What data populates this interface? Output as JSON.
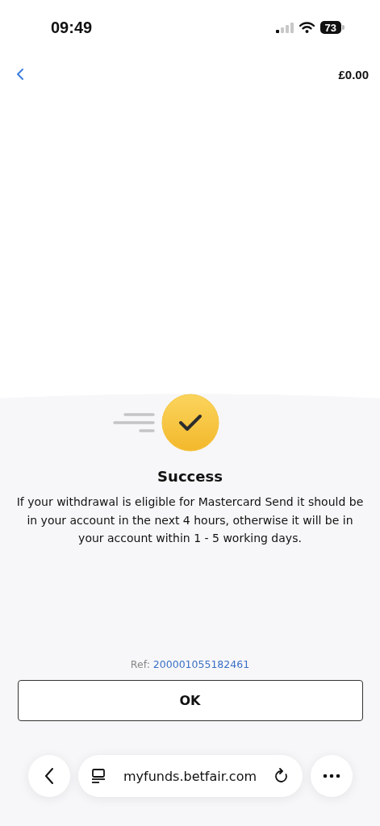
{
  "status_bar": {
    "time": "09:49",
    "battery": "73"
  },
  "header": {
    "balance": "£0.00"
  },
  "result": {
    "title": "Success",
    "message": "If your withdrawal is eligible for Mastercard Send it should be in your account in the next 4 hours, otherwise it will be in your account within 1 - 5 working days.",
    "ref_label": "Ref:",
    "ref_number": "200001055182461"
  },
  "buttons": [
    "OK"
  ],
  "browser_bar": {
    "url": "myfunds.betfair.com"
  }
}
